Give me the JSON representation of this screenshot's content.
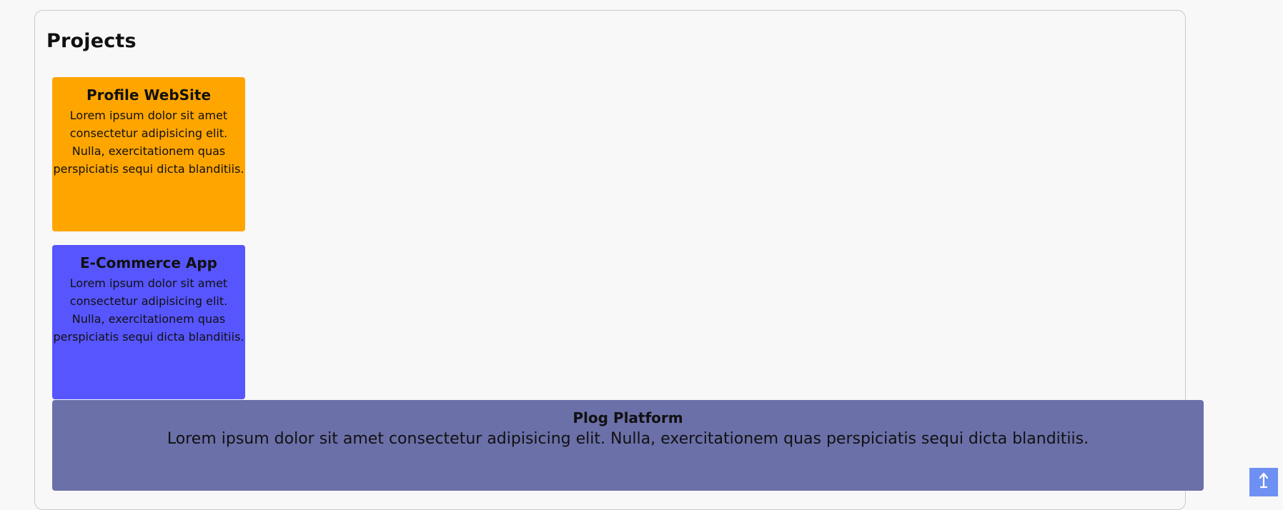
{
  "section": {
    "title": "Projects"
  },
  "projects": [
    {
      "title": "Profile WebSite",
      "description": "Lorem ipsum dolor sit amet consectetur adipisicing elit. Nulla, exercitationem quas perspiciatis sequi dicta blanditiis.",
      "color": "#ffa500"
    },
    {
      "title": "E-Commerce App",
      "description": "Lorem ipsum dolor sit amet consectetur adipisicing elit. Nulla, exercitationem quas perspiciatis sequi dicta blanditiis.",
      "color": "#5755fe"
    },
    {
      "title": "Plog Platform",
      "description": "Lorem ipsum dolor sit amet consectetur adipisicing elit. Nulla, exercitationem quas perspiciatis sequi dicta blanditiis.",
      "color": "#6b70a9"
    }
  ],
  "scroll_top": {
    "icon": "arrow-up-icon",
    "color": "#6e90f2"
  }
}
